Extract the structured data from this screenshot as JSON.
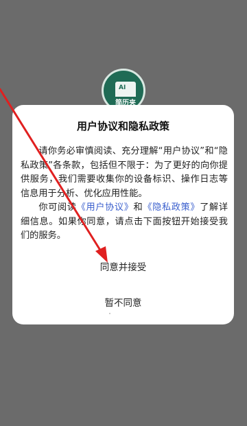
{
  "app": {
    "logo_ai": "AI",
    "logo_name": "简历夹"
  },
  "dialog": {
    "title": "用户协议和隐私政策",
    "paragraph1": "请你务必审慎阅读、充分理解“用户协议”和“隐私政策”各条款，包括但不限于：为了更好的向你提供服务，我们需要收集你的设备标识、操作日志等信息用于分析、优化应用性能。",
    "paragraph2_prefix": "你可阅读",
    "link_user_agreement": "《用户协议》",
    "paragraph2_and": "和",
    "link_privacy_policy": "《隐私政策》",
    "paragraph2_suffix": "了解详细信息。如果你同意，请点击下面按钮开始接受我们的服务。",
    "agree_label": "同意并接受",
    "disagree_label": "暂不同意"
  },
  "colors": {
    "overlay": "#6b6b6b",
    "link": "#3a5fcd",
    "annotation_arrow": "#e02020"
  }
}
